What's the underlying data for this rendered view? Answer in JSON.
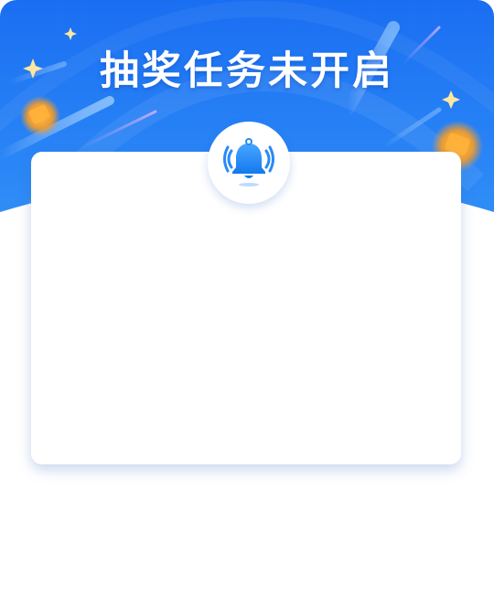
{
  "dialog": {
    "title": "抽奖任务未开启"
  },
  "icons": {
    "header_icon": "bell-ringing-icon",
    "decorations": [
      "sparkle-icon",
      "coin-icon",
      "light-streak"
    ]
  },
  "colors": {
    "banner_top": "#1a6ef2",
    "banner_bottom": "#2f8df7",
    "accent": "#1f86f5",
    "card_shadow": "#c9d6ea"
  }
}
